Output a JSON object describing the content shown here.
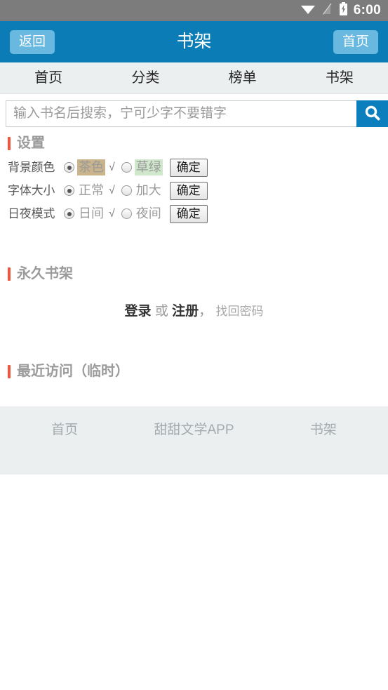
{
  "status_bar": {
    "time": "6:00",
    "icons": [
      "wifi-icon",
      "signal-off-icon",
      "battery-charging-icon"
    ],
    "bg_color": "#7c7c7c"
  },
  "title_bar": {
    "back_label": "返回",
    "title": "书架",
    "home_label": "首页",
    "bg_color": "#0b7cb5",
    "button_color": "#68b8e0"
  },
  "nav_tabs": [
    {
      "label": "首页"
    },
    {
      "label": "分类"
    },
    {
      "label": "榜单"
    },
    {
      "label": "书架"
    }
  ],
  "search": {
    "placeholder": "输入书名后搜索，宁可少字不要错字",
    "value": "",
    "button_icon": "search-icon",
    "button_color": "#0b7fbd"
  },
  "settings": {
    "section_title": "设置",
    "accent_color": "#f0543a",
    "rows": [
      {
        "label": "背景颜色",
        "option_a": "茶色",
        "option_a_bg": "#c9b48c",
        "option_b": "草绿",
        "option_b_bg": "#cfe8cb",
        "checkmark": "√",
        "selected": "a",
        "confirm": "确定"
      },
      {
        "label": "字体大小",
        "option_a": "正常",
        "option_b": "加大",
        "checkmark": "√",
        "selected": "a",
        "confirm": "确定"
      },
      {
        "label": "日夜模式",
        "option_a": "日间",
        "option_b": "夜间",
        "checkmark": "√",
        "selected": "a",
        "confirm": "确定"
      }
    ]
  },
  "permanent_shelf": {
    "section_title": "永久书架",
    "login": "登录",
    "or": "或",
    "register": "注册",
    "comma": "，",
    "forgot": "找回密码"
  },
  "recent": {
    "section_title": "最近访问（临时）"
  },
  "footer": {
    "items": [
      {
        "label": "首页"
      },
      {
        "label": "甜甜文学APP"
      },
      {
        "label": "书架"
      }
    ],
    "bg_color": "#eceff0"
  }
}
